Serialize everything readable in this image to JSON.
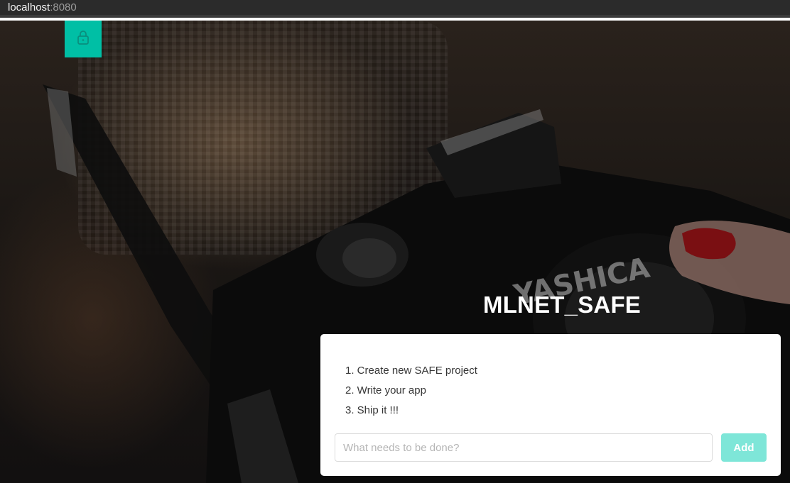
{
  "browser": {
    "host": "localhost",
    "port": ":8080"
  },
  "navbar": {
    "lock_icon": "lock-icon",
    "accent_color": "#00bfa5"
  },
  "hero": {
    "title": "MLNET_SAFE"
  },
  "todos": {
    "items": [
      "1. Create new SAFE project",
      "2. Write your app",
      "3. Ship it !!!"
    ],
    "input_value": "",
    "input_placeholder": "What needs to be done?",
    "add_label": "Add",
    "add_color": "#7ee6d8"
  }
}
